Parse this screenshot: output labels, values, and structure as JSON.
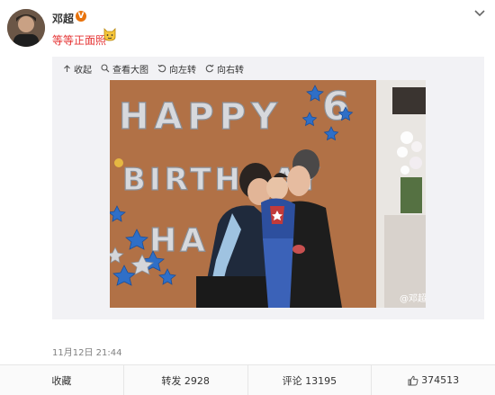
{
  "post": {
    "author": "邓超",
    "verified_badge": "V",
    "text": "等等正面照",
    "emoji": "cat-face-emoji",
    "more_icon": "chevron-down-icon"
  },
  "toolbar": {
    "collapse": "收起",
    "view_large": "查看大图",
    "rotate_left": "向左转",
    "rotate_right": "向右转"
  },
  "image": {
    "watermark": "@邓超",
    "balloons_line1": "HAPPY",
    "balloons_line2": "BIRTHDAY",
    "balloons_line3": "HA",
    "balloon_number": "6"
  },
  "timestamp": "11月12日 21:44",
  "actions": {
    "favorite": "收藏",
    "repost": "转发 2928",
    "comment": "评论 13195",
    "like": "374513"
  },
  "colors": {
    "post_text": "#e53333",
    "verified": "#e8730c",
    "wall": "#b57548"
  }
}
